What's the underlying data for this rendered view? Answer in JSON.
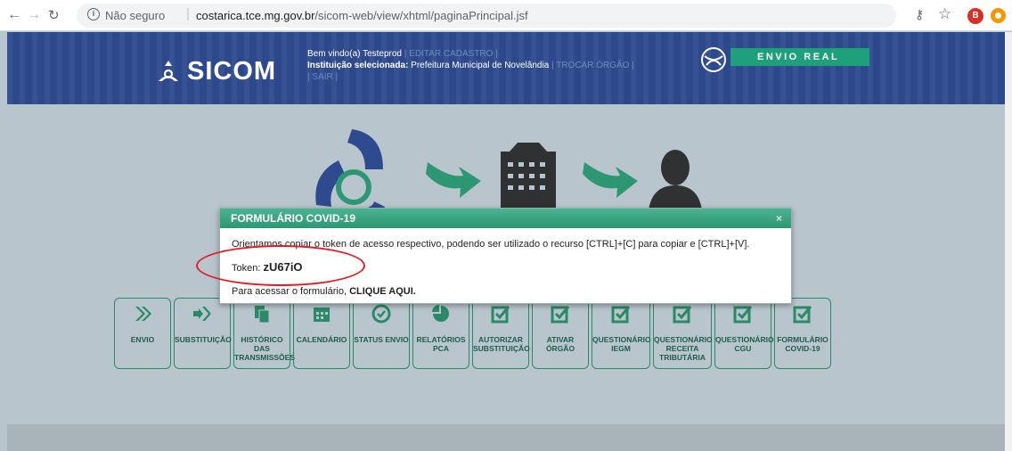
{
  "browser": {
    "security_label": "Não seguro",
    "url_host": "costarica.tce.mg.gov.br",
    "url_path": "/sicom-web/view/xhtml/paginaPrincipal.jsf",
    "avatar_letter": "B",
    "info_glyph": "i"
  },
  "header": {
    "logo_text": "SICOM",
    "welcome_prefix": "Bem vindo(a) ",
    "user_name": "Testeprod",
    "edit_link": "| EDITAR CADASTRO |",
    "institution_label": "Instituição selecionada: ",
    "institution_name": "Prefeitura Municipal de Novelândia",
    "change_link": "| TROCAR ÓRGÃO |",
    "logout_link": "| SAIR |",
    "mode_badge": "ENVIO REAL",
    "colors": {
      "header_bg": "#2e4b8f",
      "badge_bg": "#1ea07a",
      "accent_green": "#2d9774"
    }
  },
  "tiles": [
    {
      "label": "ENVIO",
      "icon": "double-chevron-icon"
    },
    {
      "label": "SUBSTITUIÇÃO",
      "icon": "arrow-chevron-icon"
    },
    {
      "label": "HISTÓRICO DAS TRANSMISSÕES",
      "icon": "documents-icon"
    },
    {
      "label": "CALENDÁRIO",
      "icon": "calendar-icon"
    },
    {
      "label": "STATUS ENVIO",
      "icon": "check-circle-icon"
    },
    {
      "label": "RELATÓRIOS PCA",
      "icon": "pie-chart-icon"
    },
    {
      "label": "AUTORIZAR SUBSTITUIÇÃO",
      "icon": "checkbox-icon"
    },
    {
      "label": "ATIVAR ÓRGÃO",
      "icon": "checkbox-icon"
    },
    {
      "label": "QUESTIONÁRIO IEGM",
      "icon": "checkbox-icon"
    },
    {
      "label": "QUESTIONÁRIO RECEITA TRIBUTÁRIA",
      "icon": "checkbox-icon"
    },
    {
      "label": "QUESTIONÁRIO CGU",
      "icon": "checkbox-icon"
    },
    {
      "label": "FORMULÁRIO COVID-19",
      "icon": "checkbox-icon"
    }
  ],
  "modal": {
    "title": "FORMULÁRIO COVID-19",
    "close": "×",
    "instruction": "Orientamos copiar o token de acesso respectivo, podendo ser utilizado o recurso [CTRL]+[C] para copiar e [CTRL]+[V].",
    "token_label": "Token: ",
    "token_value": "zU67iO",
    "access_prefix": "Para acessar o formulário, ",
    "access_link": "CLIQUE AQUI."
  }
}
